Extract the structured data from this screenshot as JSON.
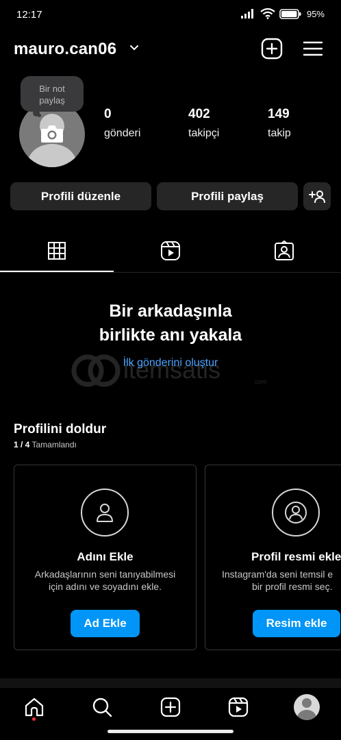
{
  "status": {
    "time": "12:17",
    "battery": "95%"
  },
  "header": {
    "username": "mauro.can06",
    "icons": [
      "chevron-down-icon",
      "add-post-icon",
      "hamburger-menu-icon"
    ]
  },
  "note": {
    "line1": "Bir not",
    "line2": "paylaş"
  },
  "stats": [
    {
      "value": "0",
      "label": "gönderi"
    },
    {
      "value": "402",
      "label": "takipçi"
    },
    {
      "value": "149",
      "label": "takip"
    }
  ],
  "buttons": {
    "edit": "Profili düzenle",
    "share": "Profili paylaş"
  },
  "tabs": [
    "grid-icon",
    "reels-icon",
    "tagged-icon"
  ],
  "empty_state": {
    "title_line1": "Bir arkadaşınla",
    "title_line2": "birlikte anı yakala",
    "link": "İlk gönderini oluştur"
  },
  "watermark": {
    "brand": "itemsatis",
    "domain": ".com"
  },
  "complete_profile": {
    "title": "Profilini doldur",
    "progress": "1 / 4",
    "progress_label": "Tamamlandı",
    "cards": [
      {
        "title": "Adını Ekle",
        "desc_line1": "Arkadaşlarının seni tanıyabilmesi",
        "desc_line2": "için adını ve soyadını ekle.",
        "button": "Ad Ekle"
      },
      {
        "title": "Profil resmi ekle",
        "desc_line1": "Instagram'da seni temsil e",
        "desc_line2": "bir profil resmi seç.",
        "button": "Resim ekle"
      }
    ]
  },
  "colors": {
    "background": "#000000",
    "button_bg": "#262626",
    "primary_blue": "#0095f6",
    "link_blue": "#4aa3ff",
    "notification_dot": "#ff3040"
  }
}
